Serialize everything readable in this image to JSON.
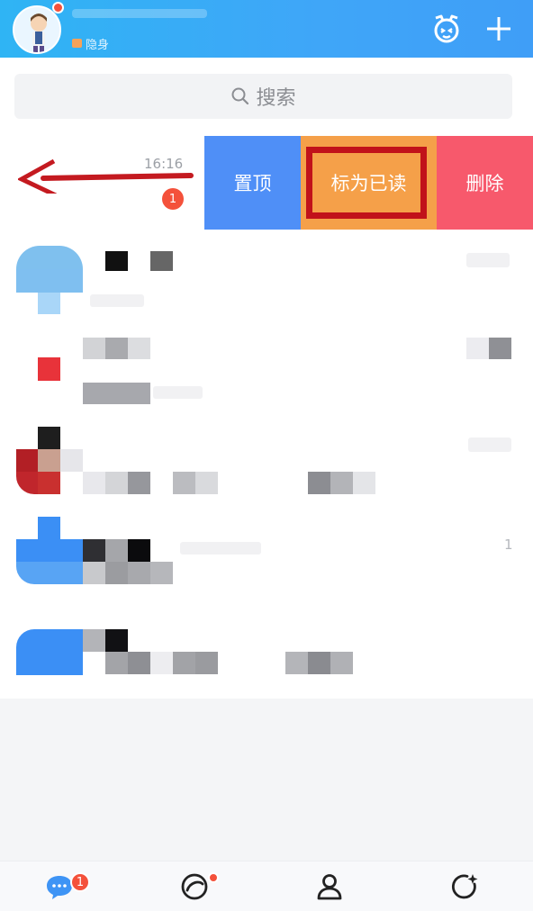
{
  "header": {
    "status_text": "隐身",
    "colors": {
      "header_gradient_start": "#2fb4f4",
      "header_gradient_end": "#3f9ef7"
    }
  },
  "search": {
    "placeholder": "搜索"
  },
  "swiped_conversation": {
    "time": "16:16",
    "unread_count": "1",
    "actions": {
      "pin_label": "置顶",
      "mark_read_label": "标为已读",
      "delete_label": "删除"
    }
  },
  "conversations_visible_text": {
    "row4_count": "1"
  },
  "tabbar": {
    "messages_badge": "1"
  },
  "colors": {
    "pin": "#4f8ff7",
    "mark_read": "#f5a049",
    "delete": "#f7596c",
    "badge": "#f4513b",
    "highlight_box": "#c1121a",
    "arrow": "#c41a20"
  }
}
